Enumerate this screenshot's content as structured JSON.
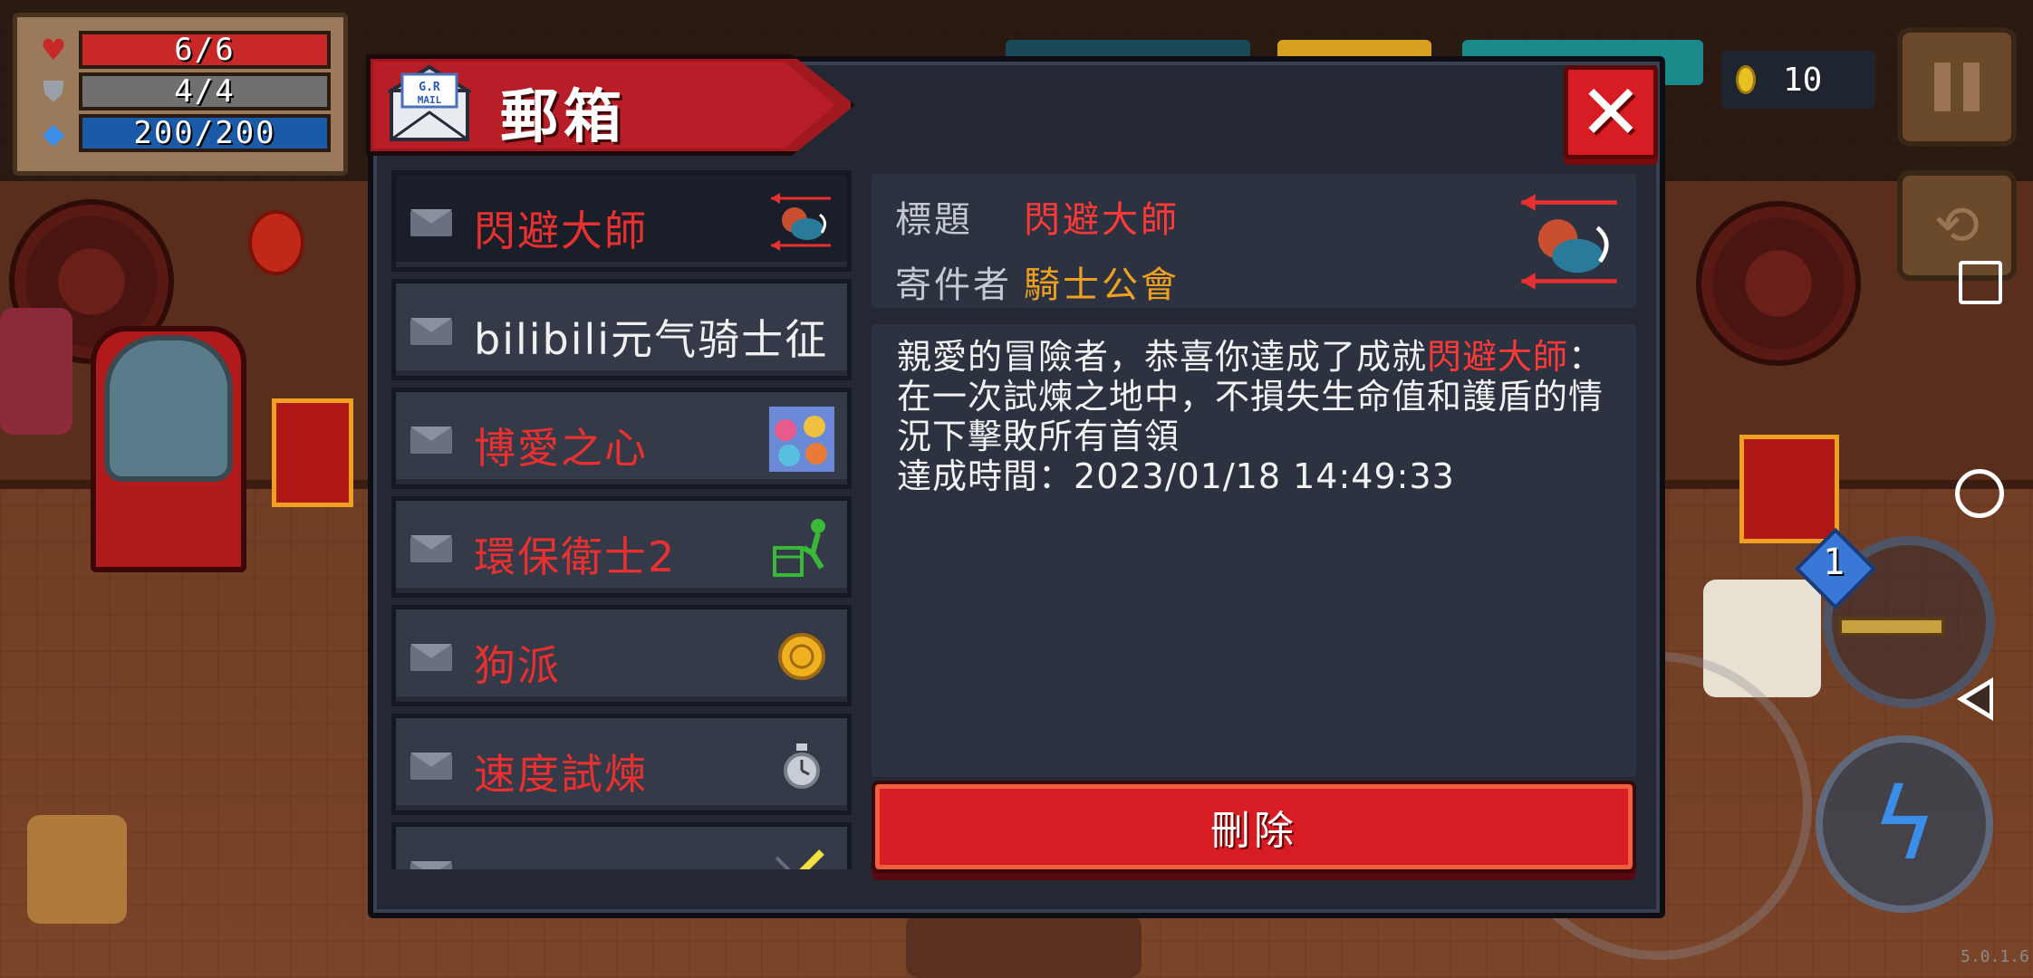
{
  "hud": {
    "hp": "6/6",
    "armor": "4/4",
    "energy": "200/200",
    "coins": "10",
    "version": "5.0.1.6"
  },
  "weapon": {
    "badge": "1"
  },
  "mailbox": {
    "title": "郵箱",
    "icon_text": "G.R MAIL",
    "close_label": "✕",
    "items": [
      {
        "label": "閃避大師",
        "color": "red",
        "thumb": "dodge-master"
      },
      {
        "label": "bilibili元气骑士征",
        "color": "white",
        "thumb": ""
      },
      {
        "label": "博愛之心",
        "color": "red",
        "thumb": "group-portrait"
      },
      {
        "label": "環保衛士2",
        "color": "red",
        "thumb": "recycle"
      },
      {
        "label": "狗派",
        "color": "red",
        "thumb": "gold-coin"
      },
      {
        "label": "速度試煉",
        "color": "red",
        "thumb": "stopwatch"
      },
      {
        "label": "",
        "color": "red",
        "thumb": "sword"
      }
    ],
    "detail": {
      "title_label": "標題",
      "title_value": "閃避大師",
      "sender_label": "寄件者",
      "sender_value": "騎士公會",
      "body_prefix": "親愛的冒險者，恭喜你達成了成就",
      "body_achievement": "閃避大師",
      "body_suffix": "：在一次試煉之地中，不損失生命值和護盾的情況下擊敗所有首領",
      "time_label": "達成時間：",
      "time_value": "2023/01/18 14:49:33",
      "delete_label": "刪除"
    }
  },
  "colors": {
    "accent_red": "#d81c24",
    "highlight_red": "#ff3838",
    "sender_gold": "#f0a020",
    "panel": "#232834"
  }
}
